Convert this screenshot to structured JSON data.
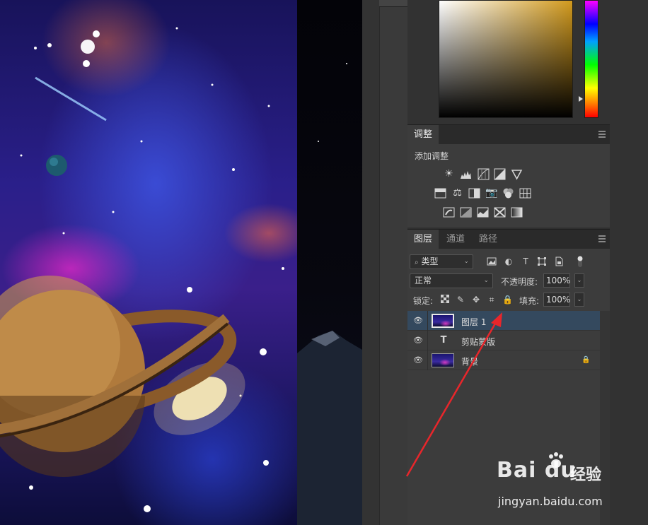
{
  "app": "Photoshop",
  "adjustments_panel": {
    "tab_label": "调整",
    "title": "添加调整",
    "icons": [
      [
        "brightness-contrast-icon",
        "levels-icon",
        "curves-icon",
        "exposure-icon",
        "vibrance-icon"
      ],
      [
        "hue-saturation-icon",
        "color-balance-icon",
        "black-white-icon",
        "photo-filter-icon",
        "channel-mixer-icon",
        "color-lookup-icon"
      ],
      [
        "invert-icon",
        "posterize-icon",
        "threshold-icon",
        "selective-color-icon",
        "gradient-map-icon"
      ]
    ]
  },
  "layers_panel": {
    "tabs": [
      "图层",
      "通道",
      "路径"
    ],
    "active_tab": "图层",
    "filter": {
      "label": "类型"
    },
    "blend_mode": "正常",
    "opacity_label": "不透明度:",
    "opacity_value": "100%",
    "lock_label": "锁定:",
    "fill_label": "填充:",
    "fill_value": "100%",
    "layers": [
      {
        "name": "图层 1",
        "type": "image",
        "selected": true,
        "locked": false
      },
      {
        "name": "剪贴蒙版",
        "type": "text",
        "selected": false,
        "locked": false
      },
      {
        "name": "背景",
        "type": "image",
        "selected": false,
        "locked": true
      }
    ]
  },
  "watermark": {
    "logo": "Bai du",
    "brand": "经验",
    "url": "jingyan.baidu.com"
  },
  "colors": {
    "selected_layer": "#34495e",
    "annotation_arrow": "#e8262b"
  }
}
